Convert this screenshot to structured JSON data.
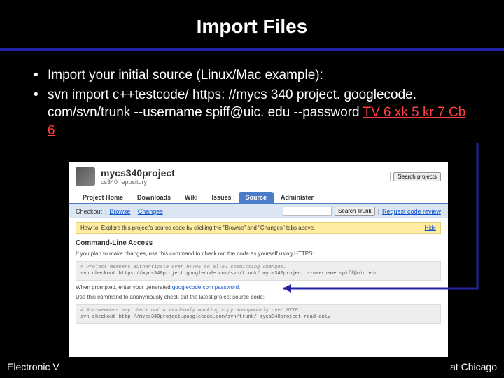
{
  "slide": {
    "title": "Import Files",
    "bullets": [
      "Import your initial source (Linux/Mac example):",
      "svn import c++testcode/ https: //mycs 340 project. googlecode. com/svn/trunk --username spiff@uic. edu --password"
    ],
    "password_token": "TV 6 xk 5 kr 7 Cb 6"
  },
  "screenshot": {
    "project_name": "mycs340project",
    "project_sub": "cs340 repository",
    "search_button": "Search projects",
    "tabs": [
      "Project Home",
      "Downloads",
      "Wiki",
      "Issues",
      "Source",
      "Administer"
    ],
    "active_tab": "Source",
    "subbar": {
      "checkout": "Checkout",
      "browse": "Browse",
      "changes": "Changes",
      "search_btn": "Search Trunk",
      "request": "Request code review"
    },
    "howto": "How-to: Explore this project's source code by clicking the \"Browse\" and \"Changes\" tabs above.",
    "howto_hide": "Hide",
    "cli_title": "Command-Line Access",
    "cli_intro": "If you plan to make changes, use this command to check out the code as yourself using HTTPS:",
    "codebox1_comment": "# Project members authenticate over HTTPS to allow committing changes.",
    "codebox1_cmd": "svn checkout https://mycs340project.googlecode.com/svn/trunk/ mycs340project --username spiff@uic.edu",
    "prompt_line_pre": "When prompted, enter your generated ",
    "prompt_link": "googlecode.com password",
    "prompt_line_post": ".",
    "anon_intro": "Use this command to anonymously check out the latest project source code:",
    "codebox2_comment": "# Non-members may check out a read-only working copy anonymously over HTTP.",
    "codebox2_cmd": "svn checkout http://mycs340project.googlecode.com/svn/trunk/ mycs340project-read-only"
  },
  "footer": {
    "left": "Electronic V",
    "right": "at Chicago"
  }
}
